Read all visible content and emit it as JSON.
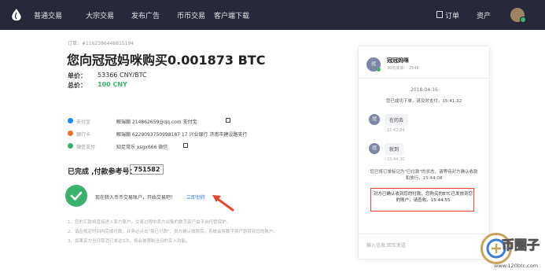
{
  "nav": {
    "items": [
      "普通交易",
      "大宗交易",
      "发布广告",
      "币币交易",
      "客户端下载"
    ],
    "orders_label": "订单",
    "assets_label": "资产"
  },
  "order": {
    "id": "订单：#1162386448815194",
    "title": "您向冠冠妈咪购买0.001873 BTC",
    "price_label": "单价：",
    "price_value": "53366 CNY/BTC",
    "total_label": "总价：",
    "total_value": "100 CNY"
  },
  "payments": [
    {
      "type": "支付宝",
      "details": "解瑞翰  214862659@qq.com  支付宝",
      "color": "#1a8ae6"
    },
    {
      "type": "银行卡",
      "details": "解瑞翰  6229093750998187 17  兴业银行  济南市建设路支行",
      "color": "#e8742b"
    },
    {
      "type": "微信支付",
      "details": "知足常乐  xsgx666  微信",
      "color": "#3bb26c"
    }
  ],
  "status": {
    "title": "已完成 ,付款参考号：",
    "ref": "751582",
    "message": "现在转入币币交易账户，开始交易吧！",
    "link": "立即划转"
  },
  "notes": [
    "1、您的汇款将直接进入卖方账户，交易过程中卖方出售的数字资产由平台托管保护。",
    "2、请在规定时间内完成付款，并务必点击\"我已付款\"，卖方确认收款后，系统会将数字资产划转到您的账户。",
    "3、如果买方当日取消订单达3次，将会被限制当日的买入功能。"
  ],
  "chat": {
    "name": "冠冠妈咪",
    "meta": "30日成单：  2548",
    "date": "2018-04-16",
    "sys1": "您已成功下单，请及时支付。15:41:32",
    "msg1": "在的去",
    "time1": "15:42:84",
    "msg2": "就到",
    "time2": "15:44:20",
    "sys2": "您已将订单标记为\"已付款\"的状态，请等待对方确认收款和放行。15:44:08",
    "sys3": "对方已确认收到您的付款，您购买的BTC已发放到您的账户，请查收。15:44:55",
    "input_placeholder": "输入信息,回车发送",
    "avatar_char": "冠"
  },
  "watermark": {
    "brand": "币圈子",
    "url": "www.120btc.com"
  },
  "colors": {
    "accent": "#3bb26c",
    "topbar": "#27293a",
    "highlight": "#e8462b"
  }
}
